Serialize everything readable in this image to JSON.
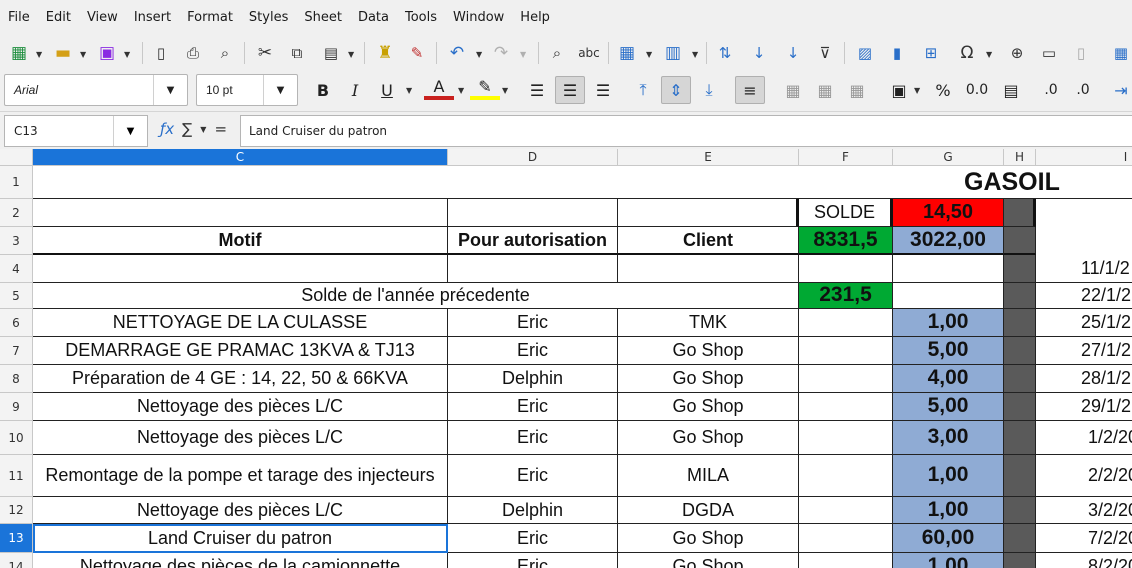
{
  "menu": [
    "File",
    "Edit",
    "View",
    "Insert",
    "Format",
    "Styles",
    "Sheet",
    "Data",
    "Tools",
    "Window",
    "Help"
  ],
  "font": {
    "name": "Arial",
    "size": "10 pt"
  },
  "formula_bar": {
    "cell_ref": "C13",
    "content": "Land Cruiser du patron"
  },
  "columns": [
    "C",
    "D",
    "E",
    "F",
    "G",
    "H",
    "I"
  ],
  "row_numbers": [
    "1",
    "2",
    "3",
    "4",
    "5",
    "6",
    "7",
    "8",
    "9",
    "10",
    "11",
    "12",
    "13",
    "14"
  ],
  "sheet": {
    "title": "GASOIL",
    "solde_label": "SOLDE",
    "solde_value": "14,50",
    "headers": {
      "motif": "Motif",
      "autorisation": "Pour autorisation",
      "client": "Client"
    },
    "f3": "8331,5",
    "g3": "3022,00",
    "r5_label": "Solde de l'année précedente",
    "r5_f": "231,5",
    "i4": "11/1/2",
    "i5": "22/1/2",
    "rows": [
      {
        "motif": "NETTOYAGE DE LA CULASSE",
        "aut": "Eric",
        "client": "TMK",
        "g": "1,00",
        "i": "25/1/2"
      },
      {
        "motif": "DEMARRAGE GE PRAMAC 13KVA & TJ13",
        "aut": "Eric",
        "client": "Go Shop",
        "g": "5,00",
        "i": "27/1/2"
      },
      {
        "motif": "Préparation de 4 GE : 14, 22, 50 & 66KVA",
        "aut": "Delphin",
        "client": "Go Shop",
        "g": "4,00",
        "i": "28/1/2"
      },
      {
        "motif": "Nettoyage des pièces L/C",
        "aut": "Eric",
        "client": "Go Shop",
        "g": "5,00",
        "i": "29/1/2"
      },
      {
        "motif": "Nettoyage des pièces L/C",
        "aut": "Eric",
        "client": "Go Shop",
        "g": "3,00",
        "i": "1/2/20"
      },
      {
        "motif": "Remontage de la pompe et tarage des injecteurs",
        "aut": "Eric",
        "client": "MILA",
        "g": "1,00",
        "i": "2/2/20"
      },
      {
        "motif": "Nettoyage des pièces L/C",
        "aut": "Delphin",
        "client": "DGDA",
        "g": "1,00",
        "i": "3/2/20"
      },
      {
        "motif": "Land Cruiser du patron",
        "aut": "Eric",
        "client": "Go Shop",
        "g": "60,00",
        "i": "7/2/20"
      },
      {
        "motif": "Nettoyage des pièces de la camionnette",
        "aut": "Eric",
        "client": "Go Shop",
        "g": "1,00",
        "i": "8/2/20"
      }
    ]
  },
  "colors": {
    "red": "#ff0000",
    "green": "#00a933",
    "blue": "#8fabd4",
    "selection": "#1a74d9"
  }
}
